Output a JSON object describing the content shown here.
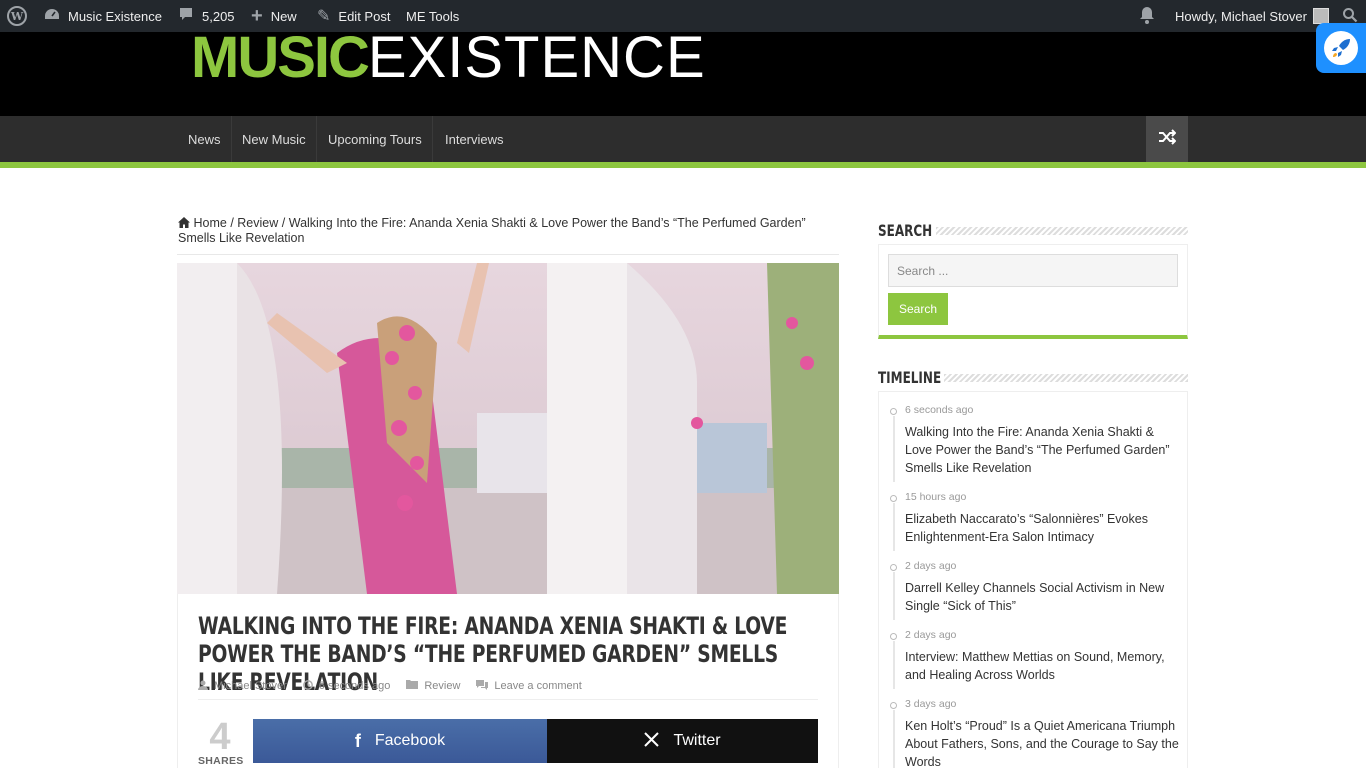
{
  "adminbar": {
    "site_name": "Music Existence",
    "comments_count": "5,205",
    "new_label": "New",
    "edit_label": "Edit Post",
    "tools_label": "ME Tools",
    "howdy": "Howdy, Michael Stover"
  },
  "header": {
    "logo_part1": "MUSIC",
    "logo_part2": "EXISTENCE"
  },
  "nav": {
    "items": [
      {
        "label": "News"
      },
      {
        "label": "New Music"
      },
      {
        "label": "Upcoming Tours"
      },
      {
        "label": "Interviews"
      }
    ]
  },
  "breadcrumb": {
    "home": "Home",
    "category": "Review",
    "current": "Walking Into the Fire: Ananda Xenia Shakti & Love Power the Band’s “The Perfumed Garden” Smells Like Revelation"
  },
  "post": {
    "title": "Walking Into the Fire: Ananda Xenia Shakti & Love Power the Band’s “The Perfumed Garden” Smells Like Revelation",
    "author": "Michael Stover",
    "time": "6 seconds ago",
    "category": "Review",
    "comments": "Leave a comment",
    "shares_count": "4",
    "shares_label": "SHARES",
    "facebook_label": "Facebook",
    "twitter_label": "Twitter"
  },
  "sidebar": {
    "search_title": "Search",
    "search_placeholder": "Search ...",
    "search_button": "Search",
    "timeline_title": "Timeline",
    "timeline": [
      {
        "time": "6 seconds ago",
        "title": "Walking Into the Fire: Ananda Xenia Shakti & Love Power the Band’s “The Perfumed Garden” Smells Like Revelation"
      },
      {
        "time": "15 hours ago",
        "title": "Elizabeth Naccarato’s “Salonnières” Evokes Enlightenment-Era Salon Intimacy"
      },
      {
        "time": "2 days ago",
        "title": "Darrell Kelley Channels Social Activism in New Single “Sick of This”"
      },
      {
        "time": "2 days ago",
        "title": "Interview: Matthew Mettias on Sound, Memory, and Healing Across Worlds"
      },
      {
        "time": "3 days ago",
        "title": "Ken Holt’s “Proud” Is a Quiet Americana Triumph About Fathers, Sons, and the Courage to Say the Words"
      }
    ]
  },
  "colors": {
    "accent": "#8dc63f",
    "admin_bar": "#23282d",
    "nav_bg": "#2d2d2d",
    "facebook": "#3b5998",
    "twitter": "#111111"
  },
  "icons": [
    "wordpress-icon",
    "dashboard-icon",
    "comment-icon",
    "plus-icon",
    "pencil-icon",
    "bell-icon",
    "search-icon",
    "rocket-icon",
    "shuffle-icon",
    "home-icon",
    "user-icon",
    "clock-icon",
    "folder-icon",
    "comments-icon",
    "facebook-icon",
    "x-twitter-icon"
  ]
}
